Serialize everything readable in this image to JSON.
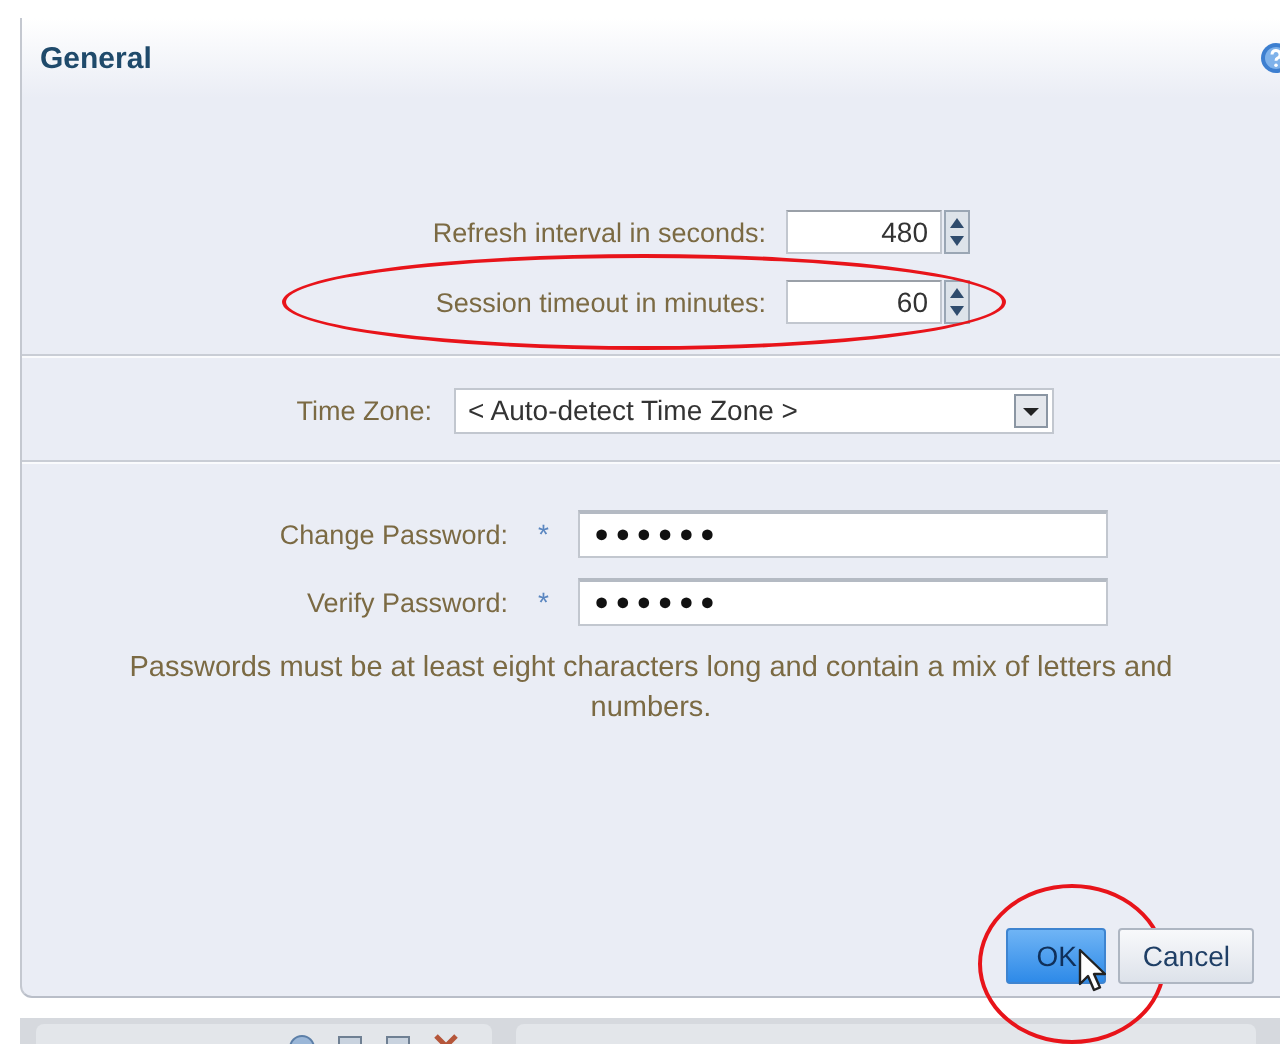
{
  "dialog": {
    "title": "General"
  },
  "spinners": [
    {
      "label": "Refresh interval in seconds:",
      "value": "480",
      "highlighted": false
    },
    {
      "label": "Session timeout in minutes:",
      "value": "60",
      "highlighted": true
    }
  ],
  "time_zone": {
    "label": "Time Zone:",
    "value": "< Auto-detect Time Zone >"
  },
  "passwords": [
    {
      "label": "Change Password:",
      "required": true,
      "value": "••••••"
    },
    {
      "label": "Verify Password:",
      "required": true,
      "value": "••••••"
    }
  ],
  "required_mark": "*",
  "note": "Passwords must be at least eight characters long and contain a mix of letters and numbers.",
  "buttons": [
    {
      "label": "OK",
      "hovered": true,
      "highlighted": true
    },
    {
      "label": "Cancel",
      "hovered": false,
      "highlighted": false
    }
  ]
}
